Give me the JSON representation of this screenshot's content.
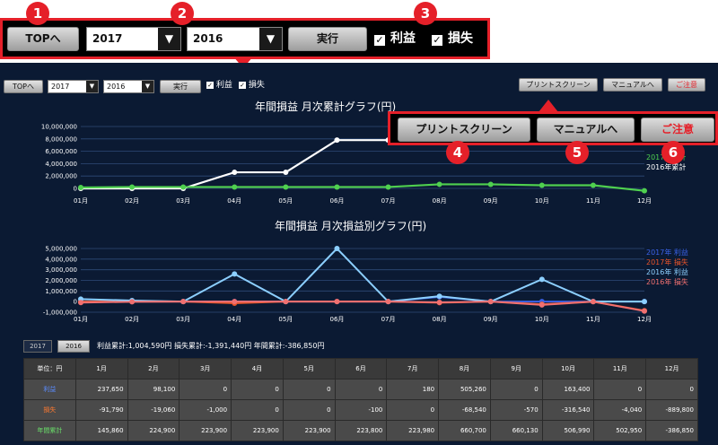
{
  "toolbar": {
    "top_label": "TOPへ",
    "year1": "2017",
    "year2": "2016",
    "run_label": "実行",
    "profit_label": "利益",
    "loss_label": "損失",
    "check_mark": "✓",
    "dropdown_arrow": "▼"
  },
  "right_buttons": {
    "print_label": "プリントスクリーン",
    "manual_label": "マニュアルへ",
    "notice_label": "ご注意"
  },
  "badges": [
    "1",
    "2",
    "3",
    "4",
    "5",
    "6"
  ],
  "colors": {
    "callout_red": "#e52029",
    "bg_navy": "#0b1a33",
    "cumulative_2017": "#ffffff",
    "cumulative_2016": "#4fd04f",
    "profit_2017": "#3a62e8",
    "loss_2017": "#e8542a",
    "profit_2016": "#8ccfff",
    "loss_2016": "#f07070"
  },
  "chart_data": [
    {
      "type": "line",
      "title": "年間損益 月次累計グラフ(円)",
      "categories": [
        "01月",
        "02月",
        "03月",
        "04月",
        "05月",
        "06月",
        "07月",
        "08月",
        "09月",
        "10月",
        "11月",
        "12月"
      ],
      "y_ticks": [
        "10,000,000",
        "8,000,000",
        "6,000,000",
        "4,000,000",
        "2,000,000",
        "0"
      ],
      "ylim": [
        0,
        10000000
      ],
      "grid": true,
      "legend_position": "right",
      "legend_labels": [
        "2017年累計",
        "2016年累計"
      ],
      "series": [
        {
          "name": "2017年累計",
          "values": [
            0,
            0,
            0,
            2600000,
            2600000,
            7800000,
            7800000,
            7800000,
            7800000,
            7800000,
            7800000,
            7800000
          ]
        },
        {
          "name": "2016年累計",
          "values": [
            145860,
            224900,
            223900,
            223900,
            223900,
            223800,
            223980,
            660700,
            660130,
            506990,
            502950,
            -386850
          ]
        }
      ]
    },
    {
      "type": "line",
      "title": "年間損益 月次損益別グラフ(円)",
      "categories": [
        "01月",
        "02月",
        "03月",
        "04月",
        "05月",
        "06月",
        "07月",
        "08月",
        "09月",
        "10月",
        "11月",
        "12月"
      ],
      "y_ticks": [
        "5,000,000",
        "4,000,000",
        "3,000,000",
        "2,000,000",
        "1,000,000",
        "0",
        "-1,000,000"
      ],
      "ylim": [
        -1000000,
        5000000
      ],
      "grid": true,
      "legend_position": "right",
      "series": [
        {
          "name": "2017年 利益",
          "values": [
            0,
            0,
            0,
            0,
            0,
            0,
            0,
            450000,
            0,
            0,
            0,
            0
          ]
        },
        {
          "name": "2017年 損失",
          "values": [
            0,
            0,
            0,
            -150000,
            0,
            0,
            0,
            -100000,
            0,
            -250000,
            0,
            -850000
          ]
        },
        {
          "name": "2016年 利益",
          "values": [
            237650,
            98100,
            0,
            2600000,
            0,
            5000000,
            180,
            505260,
            0,
            2100000,
            0,
            0
          ]
        },
        {
          "name": "2016年 損失",
          "values": [
            -91790,
            -19060,
            -1000,
            0,
            0,
            -100,
            0,
            -68540,
            -570,
            -316540,
            -4040,
            -889800
          ]
        }
      ]
    }
  ],
  "tabs": [
    "2017",
    "2016"
  ],
  "summary": "利益累計:1,004,590円 損失累計:-1,391,440円 年間累計:-386,850円",
  "table": {
    "header": [
      "単位：円",
      "1月",
      "2月",
      "3月",
      "4月",
      "5月",
      "6月",
      "7月",
      "8月",
      "9月",
      "10月",
      "11月",
      "12月"
    ],
    "rows": [
      {
        "label": "利益",
        "color": "#5b8cff",
        "cells": [
          "237,650",
          "98,100",
          "0",
          "0",
          "0",
          "0",
          "180",
          "505,260",
          "0",
          "163,400",
          "0",
          "0"
        ]
      },
      {
        "label": "損失",
        "color": "#ff7a30",
        "cells": [
          "-91,790",
          "-19,060",
          "-1,000",
          "0",
          "0",
          "-100",
          "0",
          "-68,540",
          "-570",
          "-316,540",
          "-4,040",
          "-889,800"
        ]
      },
      {
        "label": "年間累計",
        "color": "#6be36b",
        "cells": [
          "145,860",
          "224,900",
          "223,900",
          "223,900",
          "223,900",
          "223,800",
          "223,980",
          "660,700",
          "660,130",
          "506,990",
          "502,950",
          "-386,850"
        ]
      }
    ]
  }
}
